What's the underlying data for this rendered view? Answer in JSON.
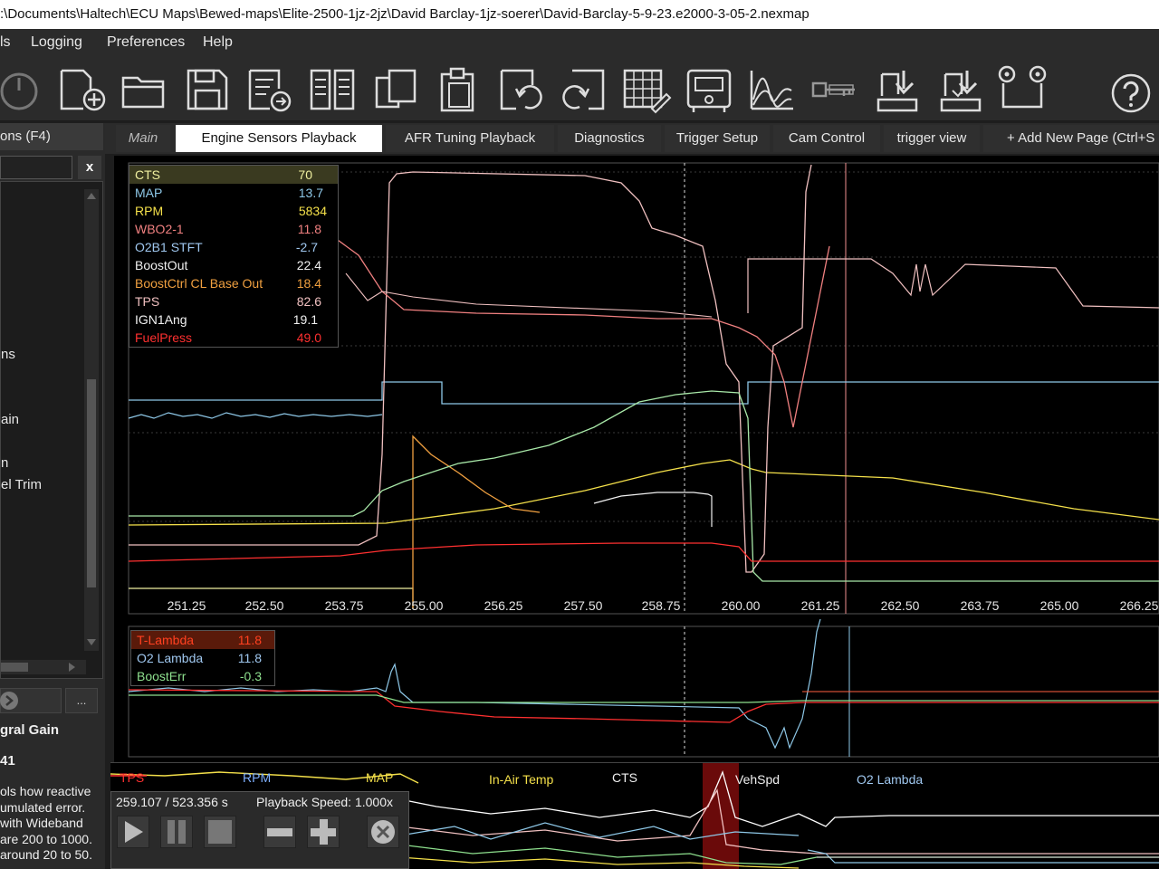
{
  "window": {
    "title": ":\\Documents\\Haltech\\ECU Maps\\Bewed-maps\\Elite-2500-1jz-2jz\\David Barclay-1jz-soerer\\David-Barclay-5-9-23.e2000-3-05-2.nexmap"
  },
  "menu": {
    "items": [
      "ls",
      "Logging",
      "Preferences",
      "Help"
    ]
  },
  "toolbar": {
    "buttons": [
      "power-icon",
      "new-file-icon",
      "open-folder-icon",
      "save-icon",
      "export-icon",
      "compare-icon",
      "copy-icon",
      "clipboard-icon",
      "undo-icon",
      "redo-icon",
      "table-edit-icon",
      "ecu-program-icon",
      "graph-icon",
      "key-icon",
      "download-icon",
      "upload-icon",
      "connect-icon",
      "help-icon"
    ]
  },
  "tabs": {
    "main": "Main",
    "items": [
      "Engine Sensors Playback",
      "AFR Tuning Playback",
      "Diagnostics",
      "Trigger Setup",
      "Cam Control",
      "trigger view",
      "+ Add New Page (Ctrl+S"
    ]
  },
  "sidebar": {
    "header": "ons (F4)",
    "close": "x",
    "list": [
      "ns",
      "ain",
      "n",
      "el Trim"
    ],
    "more_button": "...",
    "property_title": "gral Gain",
    "property_value": "41",
    "description": [
      "ols how reactive",
      "umulated error.",
      "with Wideband",
      "are 200 to 1000.",
      "around 20 to 50."
    ]
  },
  "main_graph": {
    "legend": [
      {
        "name": "CTS",
        "value": "70",
        "color": "#f0f0a0",
        "highlight": true
      },
      {
        "name": "MAP",
        "value": "13.7",
        "color": "#8ec8e8"
      },
      {
        "name": "RPM",
        "value": "5834",
        "color": "#f4e04a"
      },
      {
        "name": "WBO2-1",
        "value": "11.8",
        "color": "#f08080"
      },
      {
        "name": "O2B1 STFT",
        "value": "-2.7",
        "color": "#a0c8f0"
      },
      {
        "name": "BoostOut",
        "value": "22.4",
        "color": "#f0f0f0"
      },
      {
        "name": "BoostCtrl CL Base Out",
        "value": "18.4",
        "color": "#f0a040"
      },
      {
        "name": "TPS",
        "value": "82.6",
        "color": "#f0c0c0"
      },
      {
        "name": "IGN1Ang",
        "value": "19.1",
        "color": "#f0f0f0"
      },
      {
        "name": "FuelPress",
        "value": "49.0",
        "color": "#ff3030"
      }
    ],
    "x_ticks": [
      "251.25",
      "252.50",
      "253.75",
      "255.00",
      "256.25",
      "257.50",
      "258.75",
      "260.00",
      "261.25",
      "262.50",
      "263.75",
      "265.00",
      "266.25"
    ]
  },
  "lower_graph": {
    "legend": [
      {
        "name": "T-Lambda",
        "value": "11.8",
        "color": "#ff4020",
        "highlight": true
      },
      {
        "name": "O2 Lambda",
        "value": "11.8",
        "color": "#a0c8f0"
      },
      {
        "name": "BoostErr",
        "value": "-0.3",
        "color": "#8ee08e"
      }
    ]
  },
  "strip": {
    "labels": [
      {
        "text": "TPS",
        "color": "#ff3030"
      },
      {
        "text": "RPM",
        "color": "#7fb0ff"
      },
      {
        "text": "MAP",
        "color": "#f4e04a"
      },
      {
        "text": "In-Air Temp",
        "color": "#f4e04a"
      },
      {
        "text": "CTS",
        "color": "#f0f0f0"
      },
      {
        "text": "VehSpd",
        "color": "#f0f0f0"
      },
      {
        "text": "O2 Lambda",
        "color": "#a0c8f0"
      }
    ]
  },
  "playback": {
    "time": "259.107 / 523.356 s",
    "speed": "Playback Speed: 1.000x",
    "buttons": [
      "play-icon",
      "pause-icon",
      "stop-icon",
      "minus-icon",
      "plus-icon",
      "close-circle-icon"
    ]
  }
}
